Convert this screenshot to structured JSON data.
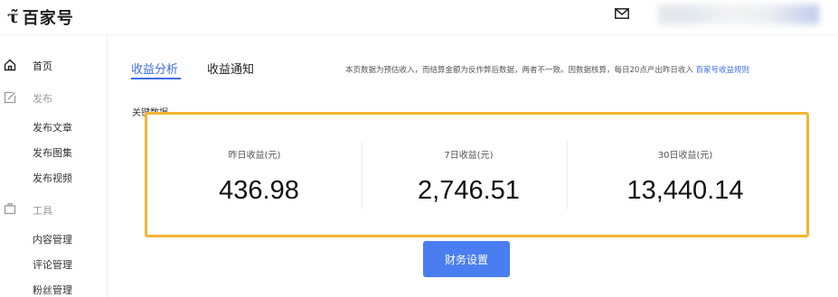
{
  "header": {
    "logo_text": "百家号",
    "icons": {
      "logo": "bjh-logo-icon",
      "mail": "mail-icon"
    }
  },
  "sidebar": {
    "items": [
      {
        "label": "首页",
        "icon": "home-icon"
      },
      {
        "label": "发布",
        "icon": "edit-icon"
      },
      {
        "label": "发布文章"
      },
      {
        "label": "发布图集"
      },
      {
        "label": "发布视频"
      },
      {
        "label": "工具",
        "icon": "toolbox-icon"
      },
      {
        "label": "内容管理"
      },
      {
        "label": "评论管理"
      },
      {
        "label": "粉丝管理"
      }
    ]
  },
  "tabs": [
    {
      "label": "收益分析",
      "active": true
    },
    {
      "label": "收益通知",
      "active": false
    }
  ],
  "notice": {
    "text": "本页数据为预估收入，而结算金额为反作弊后数据，两者不一致。因数据核算，每日20点产出昨日收入",
    "link": "百家号收益规则"
  },
  "section_label": "关键数据",
  "stats": [
    {
      "label": "昨日收益(元)",
      "value": "436.98"
    },
    {
      "label": "7日收益(元)",
      "value": "2,746.51"
    },
    {
      "label": "30日收益(元)",
      "value": "13,440.14"
    }
  ],
  "finance_button": {
    "label": "财务设置"
  },
  "colors": {
    "accent": "#3b6ee5",
    "highlight": "#f3b630",
    "button": "#4a7ef0"
  }
}
